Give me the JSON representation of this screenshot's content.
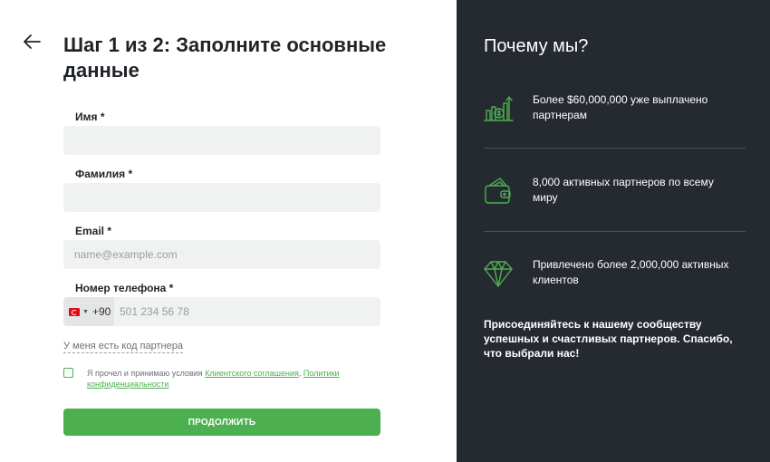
{
  "form": {
    "title": "Шаг 1 из 2: Заполните основные данные",
    "first_name": {
      "label": "Имя *",
      "value": "",
      "placeholder": ""
    },
    "last_name": {
      "label": "Фамилия *",
      "value": "",
      "placeholder": ""
    },
    "email": {
      "label": "Email *",
      "value": "",
      "placeholder": "name@example.com"
    },
    "phone": {
      "label": "Номер телефона *",
      "country_code": "+90",
      "value": "",
      "placeholder": "501 234 56 78"
    },
    "partner_code_link": "У меня есть код партнера",
    "terms": {
      "prefix": "Я прочел и принимаю условия",
      "link1": "Клиентского соглашения",
      "separator": ",",
      "link2": "Политики конфиденциальности",
      "checked": false
    },
    "continue_label": "ПРОДОЛЖИТЬ"
  },
  "sidebar": {
    "title": "Почему мы?",
    "features": [
      {
        "icon": "money-growth-icon",
        "text": "Более $60,000,000 уже выплачено партнерам"
      },
      {
        "icon": "wallet-icon",
        "text": "8,000 активных партнеров по всему миру"
      },
      {
        "icon": "diamond-icon",
        "text": "Привлечено более 2,000,000 активных клиентов"
      }
    ],
    "footer": "Присоединяйтесь к нашему сообществу успешных и счастливых партнеров. Спасибо, что выбрали нас!"
  },
  "colors": {
    "accent": "#4caf50",
    "sidebar_bg": "#252a31",
    "input_bg": "#f0f1f1"
  }
}
